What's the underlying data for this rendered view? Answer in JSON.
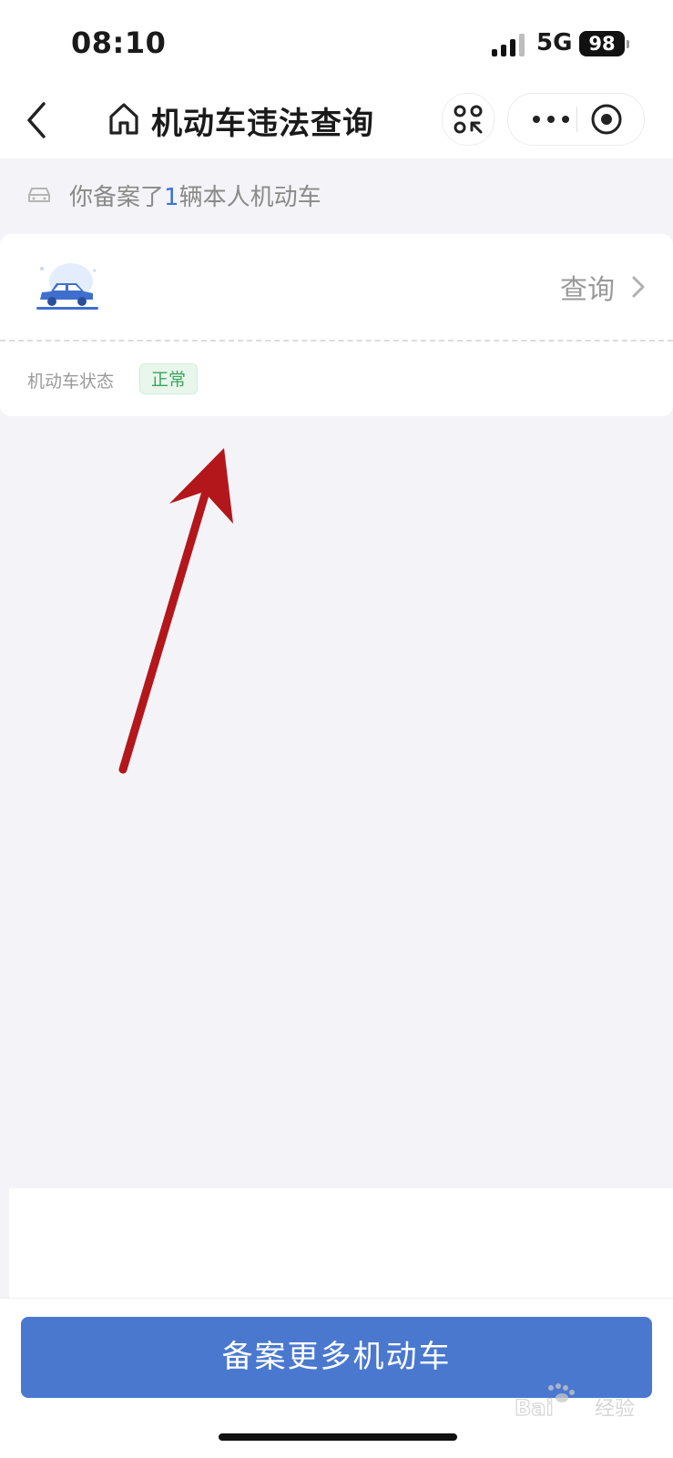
{
  "status_bar": {
    "time": "08:10",
    "network": "5G",
    "battery": "98"
  },
  "nav": {
    "title": "机动车违法查询",
    "icons": {
      "back": "chevron-left-icon",
      "home": "home-icon",
      "scan": "scan-icon",
      "more": "more-dots-icon",
      "close": "target-icon"
    }
  },
  "info": {
    "prefix": "你备案了",
    "count": "1",
    "suffix": "辆本人机动车"
  },
  "vehicle_card": {
    "action_label": "查询",
    "status_label": "机动车状态",
    "status_value": "正常"
  },
  "footer": {
    "primary_button": "备案更多机动车"
  },
  "colors": {
    "accent": "#4a78cf",
    "count_blue": "#3d72d6",
    "status_green": "#3ba55c",
    "annotation_arrow": "#b3171b"
  }
}
